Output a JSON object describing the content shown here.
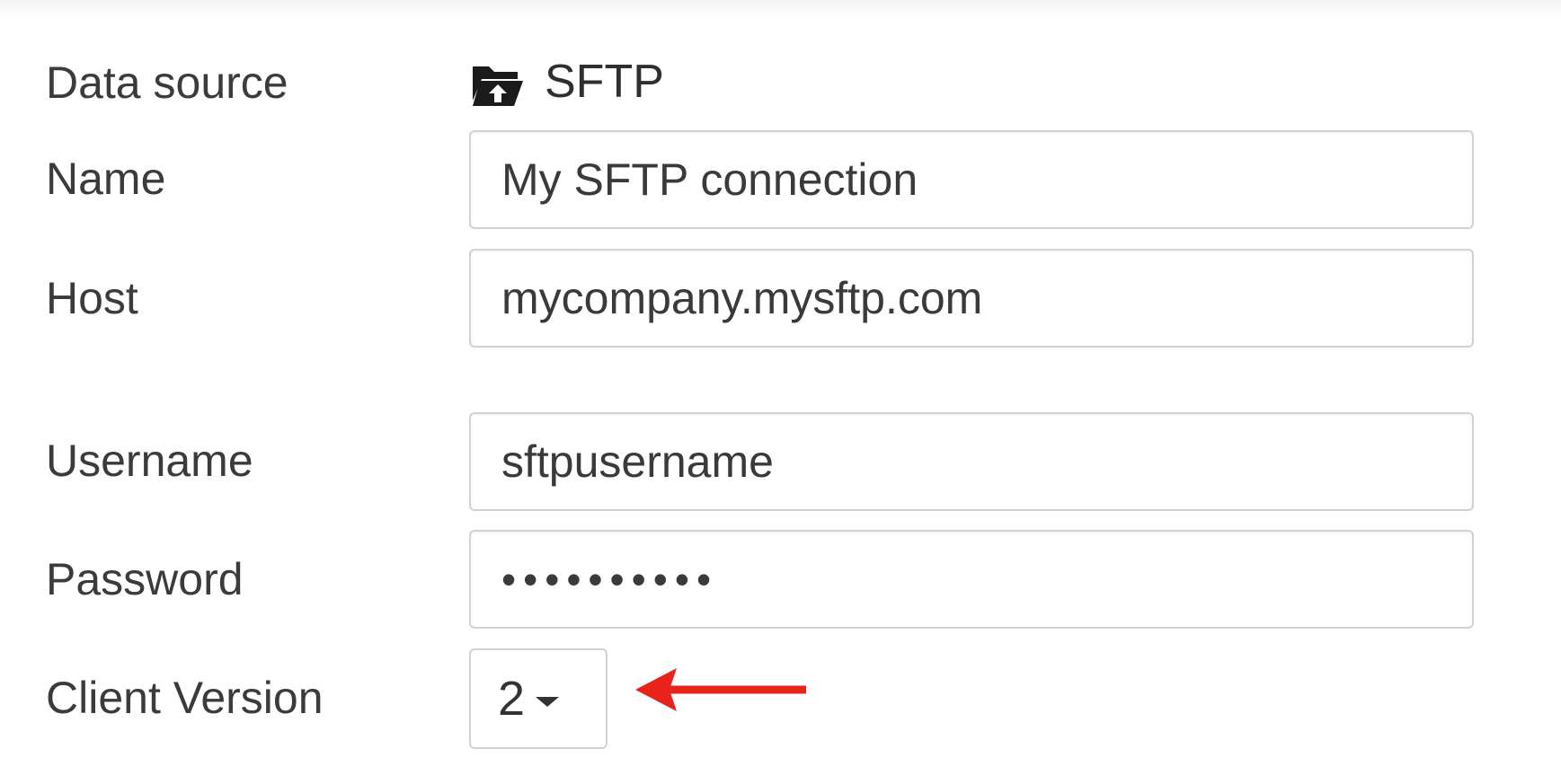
{
  "form": {
    "data_source": {
      "label": "Data source",
      "value": "SFTP",
      "icon": "folder-upload-icon"
    },
    "name": {
      "label": "Name",
      "value": "My SFTP connection"
    },
    "host": {
      "label": "Host",
      "value": "mycompany.mysftp.com"
    },
    "username": {
      "label": "Username",
      "value": "sftpusername"
    },
    "password": {
      "label": "Password",
      "value": "••••••••••"
    },
    "client_version": {
      "label": "Client Version",
      "value": "2",
      "icon": "caret-down-icon"
    }
  },
  "annotation": {
    "icon": "red-arrow-icon",
    "color": "#e8231c"
  }
}
